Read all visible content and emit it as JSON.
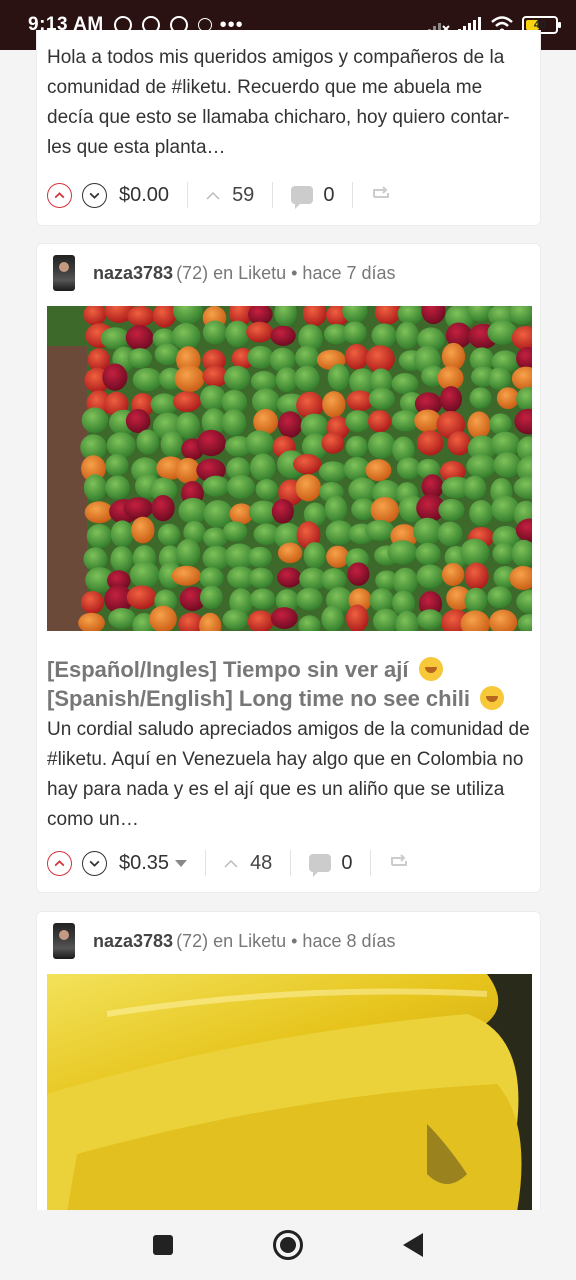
{
  "status_bar": {
    "time": "9:13 AM",
    "dots": "•••",
    "battery_level": "40",
    "icons_left": [
      "alarm-icon",
      "whatsapp-icon",
      "no-disturb-icon",
      "dollar-icon"
    ],
    "icons_right": [
      "signal-off-icon",
      "signal-icon",
      "wifi-icon",
      "battery-icon"
    ]
  },
  "posts": [
    {
      "excerpt": "Hola a todos mis queridos amigos y compañeros de la comunidad de #liketu. Recuerdo que me abuela me decía que esto se llamaba chicharo, hoy quiero contar-les que esta planta…",
      "payout": "$0.00",
      "votes": "59",
      "comments": "0"
    },
    {
      "author": "naza3783",
      "reputation": "(72)",
      "meta": "en Liketu • hace 7 días",
      "title_line1": "[Español/Ingles] Tiempo sin ver ají",
      "title_line2": "[Spanish/English] Long time no see chili",
      "excerpt": "Un cordial saludo apreciados amigos de la comunidad de #liketu. Aquí en Venezuela hay algo que en Colombia no hay para nada y es el ají que es un aliño que se utiliza como un…",
      "payout": "$0.35",
      "votes": "48",
      "comments": "0"
    },
    {
      "author": "naza3783",
      "reputation": "(72)",
      "meta": "en Liketu • hace 8 días"
    }
  ],
  "colors": {
    "status_bar_bg": "#2a1212",
    "upvote": "#d0353c",
    "title_gray": "#777777"
  }
}
